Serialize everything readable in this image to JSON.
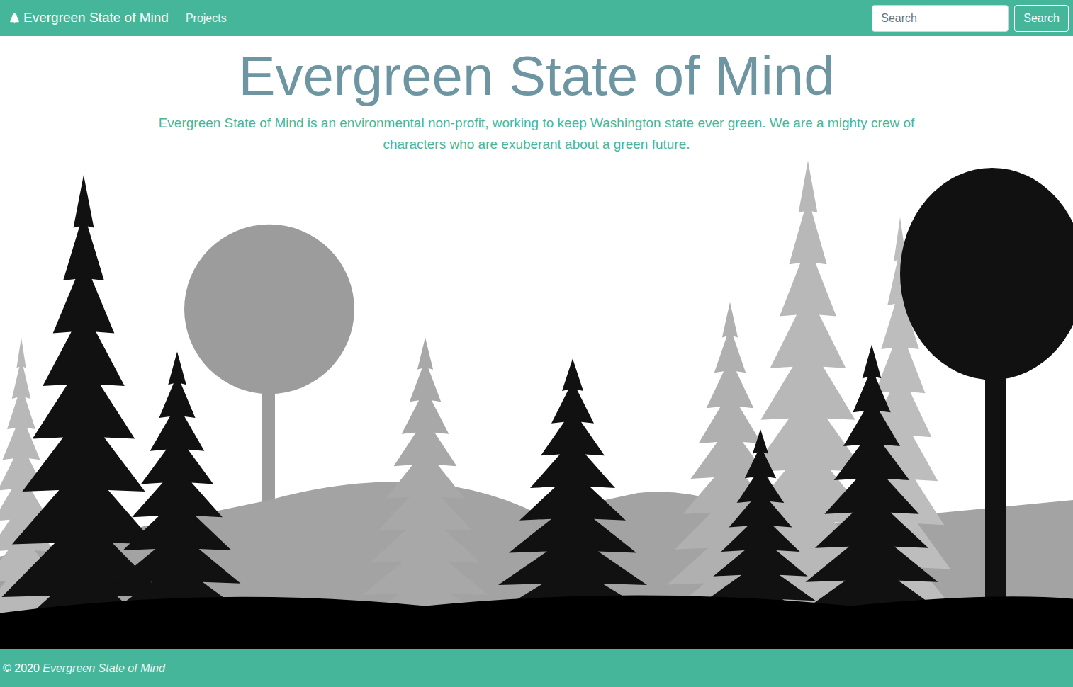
{
  "navbar": {
    "brand": "Evergreen State of Mind",
    "links": [
      {
        "label": "Projects",
        "selected": false
      }
    ],
    "search": {
      "placeholder": "Search",
      "button": "Search"
    }
  },
  "hero": {
    "title": "Evergreen State of Mind",
    "description": "Evergreen State of Mind is an environmental non-profit, working to keep Washington state ever green. We are a mighty crew of characters who are exuberant about a green future."
  },
  "footer": {
    "copyright": "© 2020",
    "name": "Evergreen State of Mind"
  }
}
